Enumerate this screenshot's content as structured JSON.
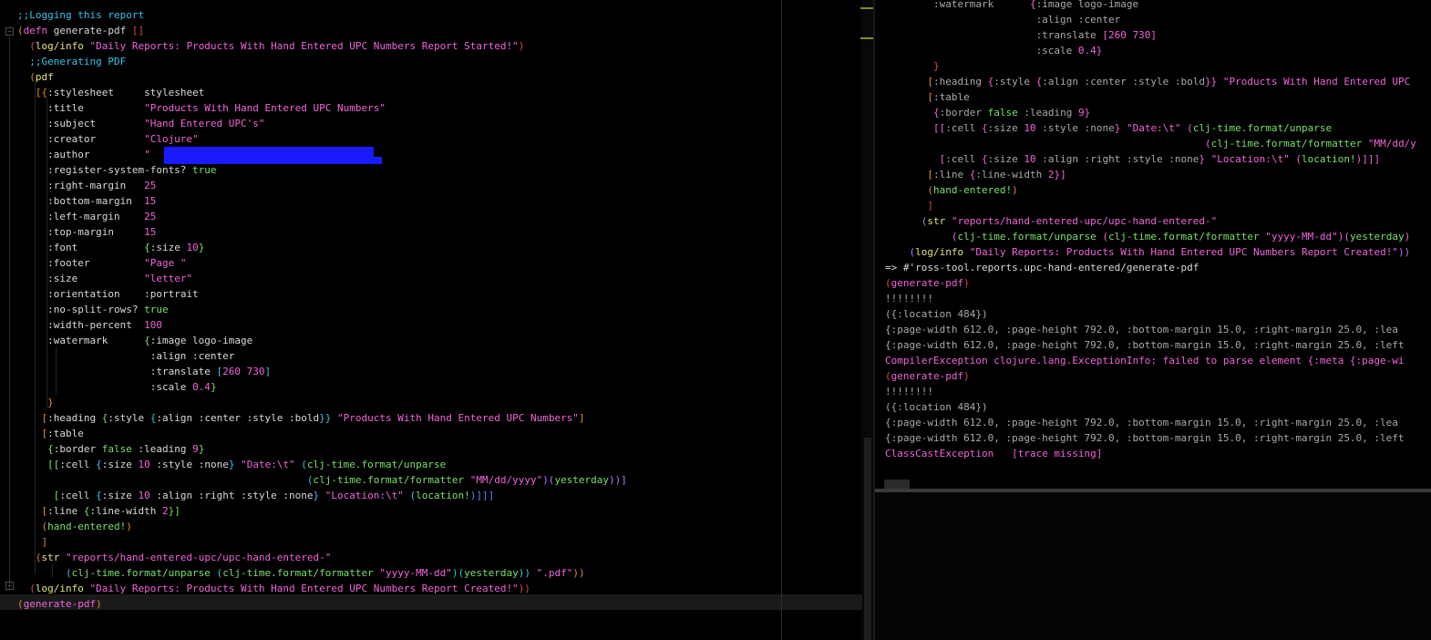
{
  "editor": {
    "lines": [
      [
        {
          "t": ";;Logging this report",
          "c": "cyan"
        }
      ],
      [
        {
          "t": "(",
          "c": "orange"
        },
        {
          "t": "defn",
          "c": "pink"
        },
        {
          "t": " generate-pdf ",
          "c": "white"
        },
        {
          "t": "[]",
          "c": "red"
        }
      ],
      [
        {
          "t": "  (",
          "c": "red"
        },
        {
          "t": "log/info",
          "c": "yellow"
        },
        {
          "t": " \"Daily Reports: Products With Hand Entered UPC Numbers Report Started!\"",
          "c": "pink"
        },
        {
          "t": ")",
          "c": "red"
        }
      ],
      [
        {
          "t": "  ;;Generating PDF",
          "c": "cyan"
        }
      ],
      [
        {
          "t": "  (",
          "c": "orange"
        },
        {
          "t": "pdf",
          "c": "yellow"
        }
      ],
      [
        {
          "t": "   [{",
          "c": "orange"
        },
        {
          "t": ":stylesheet",
          "c": "white"
        },
        {
          "t": "     stylesheet",
          "c": "white"
        }
      ],
      [
        {
          "t": "     :title",
          "c": "white"
        },
        {
          "t": "          \"Products With Hand Entered UPC Numbers\"",
          "c": "pink"
        }
      ],
      [
        {
          "t": "     :subject",
          "c": "white"
        },
        {
          "t": "        \"Hand Entered UPC's\"",
          "c": "pink"
        }
      ],
      [
        {
          "t": "     :creator",
          "c": "white"
        },
        {
          "t": "        \"Clojure\"",
          "c": "pink"
        }
      ],
      [
        {
          "t": "     :author",
          "c": "white"
        },
        {
          "t": "         \"",
          "c": "pink"
        }
      ],
      [
        {
          "t": "     :register-system-fonts?",
          "c": "white"
        },
        {
          "t": " true",
          "c": "green"
        }
      ],
      [
        {
          "t": "     :right-margin",
          "c": "white"
        },
        {
          "t": "   25",
          "c": "pink"
        }
      ],
      [
        {
          "t": "     :bottom-margin",
          "c": "white"
        },
        {
          "t": "  15",
          "c": "pink"
        }
      ],
      [
        {
          "t": "     :left-margin",
          "c": "white"
        },
        {
          "t": "    25",
          "c": "pink"
        }
      ],
      [
        {
          "t": "     :top-margin",
          "c": "white"
        },
        {
          "t": "     15",
          "c": "pink"
        }
      ],
      [
        {
          "t": "     :font",
          "c": "white"
        },
        {
          "t": "           {",
          "c": "green"
        },
        {
          "t": ":size ",
          "c": "white"
        },
        {
          "t": "10",
          "c": "pink"
        },
        {
          "t": "}",
          "c": "green"
        }
      ],
      [
        {
          "t": "     :footer",
          "c": "white"
        },
        {
          "t": "         \"Page \"",
          "c": "pink"
        }
      ],
      [
        {
          "t": "     :size",
          "c": "white"
        },
        {
          "t": "           \"letter\"",
          "c": "pink"
        }
      ],
      [
        {
          "t": "     :orientation",
          "c": "white"
        },
        {
          "t": "    :portrait",
          "c": "white"
        }
      ],
      [
        {
          "t": "     :no-split-rows?",
          "c": "white"
        },
        {
          "t": " true",
          "c": "green"
        }
      ],
      [
        {
          "t": "     :width-percent",
          "c": "white"
        },
        {
          "t": "  100",
          "c": "pink"
        }
      ],
      [
        {
          "t": "     :watermark",
          "c": "white"
        },
        {
          "t": "      {",
          "c": "green"
        },
        {
          "t": ":image logo-image",
          "c": "white"
        }
      ],
      [
        {
          "t": "                      :align :center",
          "c": "white"
        }
      ],
      [
        {
          "t": "                      :translate ",
          "c": "white"
        },
        {
          "t": "[",
          "c": "cyan"
        },
        {
          "t": "260 730",
          "c": "pink"
        },
        {
          "t": "]",
          "c": "cyan"
        }
      ],
      [
        {
          "t": "                      :scale ",
          "c": "white"
        },
        {
          "t": "0.4",
          "c": "pink"
        },
        {
          "t": "}",
          "c": "green"
        }
      ],
      [
        {
          "t": "     }",
          "c": "orange"
        }
      ],
      [
        {
          "t": "    [",
          "c": "orange"
        },
        {
          "t": ":heading ",
          "c": "white"
        },
        {
          "t": "{",
          "c": "green"
        },
        {
          "t": ":style ",
          "c": "white"
        },
        {
          "t": "{",
          "c": "cyan"
        },
        {
          "t": ":align :center :style :bold",
          "c": "white"
        },
        {
          "t": "}}",
          "c": "cyan"
        },
        {
          "t": " \"Products With Hand Entered UPC Numbers\"",
          "c": "pink"
        },
        {
          "t": "]",
          "c": "orange"
        }
      ],
      [
        {
          "t": "    [",
          "c": "orange"
        },
        {
          "t": ":table",
          "c": "white"
        }
      ],
      [
        {
          "t": "     {",
          "c": "green"
        },
        {
          "t": ":border ",
          "c": "white"
        },
        {
          "t": "false",
          "c": "green"
        },
        {
          "t": " :leading ",
          "c": "white"
        },
        {
          "t": "9",
          "c": "pink"
        },
        {
          "t": "}",
          "c": "green"
        }
      ],
      [
        {
          "t": "     [[",
          "c": "green"
        },
        {
          "t": ":cell ",
          "c": "white"
        },
        {
          "t": "{",
          "c": "cyan"
        },
        {
          "t": ":size ",
          "c": "white"
        },
        {
          "t": "10",
          "c": "pink"
        },
        {
          "t": " :style :none",
          "c": "white"
        },
        {
          "t": "}",
          "c": "cyan"
        },
        {
          "t": " \"Date:\\t\"",
          "c": "pink"
        },
        {
          "t": " (",
          "c": "cyan"
        },
        {
          "t": "clj-time.format/unparse",
          "c": "green"
        }
      ],
      [
        {
          "t": "                                                (",
          "c": "cyan"
        },
        {
          "t": "clj-time.format/formatter",
          "c": "green"
        },
        {
          "t": " \"MM/dd/yyyy\"",
          "c": "pink"
        },
        {
          "t": ")(",
          "c": "purple"
        },
        {
          "t": "yesterday",
          "c": "green"
        },
        {
          "t": "))]",
          "c": "purple"
        }
      ],
      [
        {
          "t": "      [",
          "c": "green"
        },
        {
          "t": ":cell ",
          "c": "white"
        },
        {
          "t": "{",
          "c": "cyan"
        },
        {
          "t": ":size ",
          "c": "white"
        },
        {
          "t": "10",
          "c": "pink"
        },
        {
          "t": " :align :right :style :none",
          "c": "white"
        },
        {
          "t": "}",
          "c": "cyan"
        },
        {
          "t": " \"Location:\\t\"",
          "c": "pink"
        },
        {
          "t": " (",
          "c": "cyan"
        },
        {
          "t": "location!",
          "c": "green"
        },
        {
          "t": ")]]]",
          "c": "blue"
        }
      ],
      [
        {
          "t": "    [",
          "c": "orange"
        },
        {
          "t": ":line ",
          "c": "white"
        },
        {
          "t": "{",
          "c": "green"
        },
        {
          "t": ":line-width ",
          "c": "white"
        },
        {
          "t": "2",
          "c": "pink"
        },
        {
          "t": "}]",
          "c": "green"
        }
      ],
      [
        {
          "t": "    (",
          "c": "orange"
        },
        {
          "t": "hand-entered!",
          "c": "green"
        },
        {
          "t": ")",
          "c": "orange"
        }
      ],
      [
        {
          "t": "    ]",
          "c": "orange"
        }
      ],
      [
        {
          "t": "   (",
          "c": "orange"
        },
        {
          "t": "str",
          "c": "yellow"
        },
        {
          "t": " \"reports/hand-entered-upc/upc-hand-entered-\"",
          "c": "pink"
        }
      ],
      [
        {
          "t": "        (",
          "c": "cyan"
        },
        {
          "t": "clj-time.format/unparse",
          "c": "green"
        },
        {
          "t": " (",
          "c": "cyan"
        },
        {
          "t": "clj-time.format/formatter",
          "c": "green"
        },
        {
          "t": " \"yyyy-MM-dd\"",
          "c": "pink"
        },
        {
          "t": ")(",
          "c": "cyan"
        },
        {
          "t": "yesterday",
          "c": "green"
        },
        {
          "t": "))",
          "c": "cyan"
        },
        {
          "t": " \".pdf\"",
          "c": "pink"
        },
        {
          "t": "))",
          "c": "orange"
        }
      ],
      [
        {
          "t": "  (",
          "c": "red"
        },
        {
          "t": "log/info",
          "c": "yellow"
        },
        {
          "t": " \"Daily Reports: Products With Hand Entered UPC Numbers Report Created!\"",
          "c": "pink"
        },
        {
          "t": "))",
          "c": "red"
        }
      ],
      [
        {
          "t": "(",
          "c": "orange"
        },
        {
          "t": "generate-pdf",
          "c": "pink"
        },
        {
          "t": ")",
          "c": "orange"
        }
      ]
    ]
  },
  "repl": {
    "lines": [
      [
        {
          "t": "        :watermark",
          "c": "gray"
        },
        {
          "t": "      {",
          "c": "pink"
        },
        {
          "t": ":image logo-image",
          "c": "gray"
        }
      ],
      [
        {
          "t": "                         :align :center",
          "c": "gray"
        }
      ],
      [
        {
          "t": "                         :translate ",
          "c": "gray"
        },
        {
          "t": "[260 730]",
          "c": "pink"
        }
      ],
      [
        {
          "t": "                         :scale ",
          "c": "gray"
        },
        {
          "t": "0.4}",
          "c": "pink"
        }
      ],
      [
        {
          "t": "        }",
          "c": "red"
        }
      ],
      [
        {
          "t": "       [",
          "c": "orange"
        },
        {
          "t": ":heading ",
          "c": "gray"
        },
        {
          "t": "{",
          "c": "pink"
        },
        {
          "t": ":style ",
          "c": "gray"
        },
        {
          "t": "{",
          "c": "pink"
        },
        {
          "t": ":align :center :style :bold",
          "c": "gray"
        },
        {
          "t": "}}",
          "c": "pink"
        },
        {
          "t": " \"Products With Hand Entered UPC",
          "c": "pink"
        }
      ],
      [
        {
          "t": "       [",
          "c": "orange"
        },
        {
          "t": ":table",
          "c": "gray"
        }
      ],
      [
        {
          "t": "        {",
          "c": "pink"
        },
        {
          "t": ":border ",
          "c": "gray"
        },
        {
          "t": "false",
          "c": "green"
        },
        {
          "t": " :leading ",
          "c": "gray"
        },
        {
          "t": "9}",
          "c": "pink"
        }
      ],
      [
        {
          "t": "        [[",
          "c": "pink"
        },
        {
          "t": ":cell ",
          "c": "gray"
        },
        {
          "t": "{",
          "c": "pink"
        },
        {
          "t": ":size ",
          "c": "gray"
        },
        {
          "t": "10",
          "c": "pink"
        },
        {
          "t": " :style :none",
          "c": "gray"
        },
        {
          "t": "}",
          "c": "pink"
        },
        {
          "t": " \"Date:\\t\"",
          "c": "pink"
        },
        {
          "t": " (",
          "c": "pink"
        },
        {
          "t": "clj-time.format/unparse",
          "c": "green"
        }
      ],
      [
        {
          "t": "                                                     (",
          "c": "pink"
        },
        {
          "t": "clj-time.format/formatter",
          "c": "green"
        },
        {
          "t": " \"MM/dd/y",
          "c": "pink"
        }
      ],
      [
        {
          "t": "         [",
          "c": "pink"
        },
        {
          "t": ":cell ",
          "c": "gray"
        },
        {
          "t": "{",
          "c": "pink"
        },
        {
          "t": ":size ",
          "c": "gray"
        },
        {
          "t": "10",
          "c": "pink"
        },
        {
          "t": " :align :right :style :none",
          "c": "gray"
        },
        {
          "t": "}",
          "c": "pink"
        },
        {
          "t": " \"Location:\\t\"",
          "c": "pink"
        },
        {
          "t": " (",
          "c": "pink"
        },
        {
          "t": "location!",
          "c": "green"
        },
        {
          "t": ")]]]",
          "c": "pink"
        }
      ],
      [
        {
          "t": "       [",
          "c": "orange"
        },
        {
          "t": ":line ",
          "c": "gray"
        },
        {
          "t": "{",
          "c": "pink"
        },
        {
          "t": ":line-width ",
          "c": "gray"
        },
        {
          "t": "2}]",
          "c": "pink"
        }
      ],
      [
        {
          "t": "       (",
          "c": "orange"
        },
        {
          "t": "hand-entered!",
          "c": "green"
        },
        {
          "t": ")",
          "c": "orange"
        }
      ],
      [
        {
          "t": "       ]",
          "c": "red"
        }
      ],
      [
        {
          "t": "      (",
          "c": "purple"
        },
        {
          "t": "str",
          "c": "yellow"
        },
        {
          "t": " \"reports/hand-entered-upc/upc-hand-entered-\"",
          "c": "pink"
        }
      ],
      [
        {
          "t": "           (",
          "c": "pink"
        },
        {
          "t": "clj-time.format/unparse",
          "c": "green"
        },
        {
          "t": " (",
          "c": "pink"
        },
        {
          "t": "clj-time.format/formatter",
          "c": "green"
        },
        {
          "t": " \"yyyy-MM-dd\"",
          "c": "pink"
        },
        {
          "t": ")(",
          "c": "pink"
        },
        {
          "t": "yesterday",
          "c": "green"
        },
        {
          "t": ")",
          "c": "pink"
        }
      ],
      [
        {
          "t": "    (",
          "c": "purple"
        },
        {
          "t": "log/info",
          "c": "yellow"
        },
        {
          "t": " \"Daily Reports: Products With Hand Entered UPC Numbers Report Created!\"",
          "c": "pink"
        },
        {
          "t": "))",
          "c": "purple"
        }
      ],
      [
        {
          "t": "=> #'ross-tool.reports.upc-hand-entered/generate-pdf",
          "c": "white"
        }
      ],
      [
        {
          "t": "(",
          "c": "red"
        },
        {
          "t": "generate-pdf",
          "c": "pink"
        },
        {
          "t": ")",
          "c": "red"
        }
      ],
      [
        {
          "t": "!!!!!!!!",
          "c": "gray"
        }
      ],
      [
        {
          "t": "({:location 484})",
          "c": "gray"
        }
      ],
      [
        {
          "t": "{:page-width 612.0, :page-height 792.0, :bottom-margin 15.0, :right-margin 25.0, :lea",
          "c": "gray"
        }
      ],
      [
        {
          "t": "{:page-width 612.0, :page-height 792.0, :bottom-margin 15.0, :right-margin 25.0, :left",
          "c": "gray"
        }
      ],
      [
        {
          "t": "CompilerException clojure.lang.ExceptionInfo: failed to parse element {:meta {:page-wi",
          "c": "pink"
        }
      ],
      [
        {
          "t": "(",
          "c": "red"
        },
        {
          "t": "generate-pdf",
          "c": "pink"
        },
        {
          "t": ")",
          "c": "red"
        }
      ],
      [
        {
          "t": "!!!!!!!!",
          "c": "gray"
        }
      ],
      [
        {
          "t": "({:location 484})",
          "c": "gray"
        }
      ],
      [
        {
          "t": "{:page-width 612.0, :page-height 792.0, :bottom-margin 15.0, :right-margin 25.0, :lea",
          "c": "gray"
        }
      ],
      [
        {
          "t": "{:page-width 612.0, :page-height 792.0, :bottom-margin 15.0, :right-margin 25.0, :left",
          "c": "gray"
        }
      ],
      [
        {
          "t": "ClassCastException   [trace missing]",
          "c": "pink"
        }
      ]
    ]
  },
  "colors": {
    "background": "#000000",
    "comment": "#35c4e8",
    "string": "#f065d8",
    "function": "#e7e07a",
    "keyword": "#d9d9d9",
    "boolean": "#7ae06a",
    "redaction": "#1a1aff"
  }
}
